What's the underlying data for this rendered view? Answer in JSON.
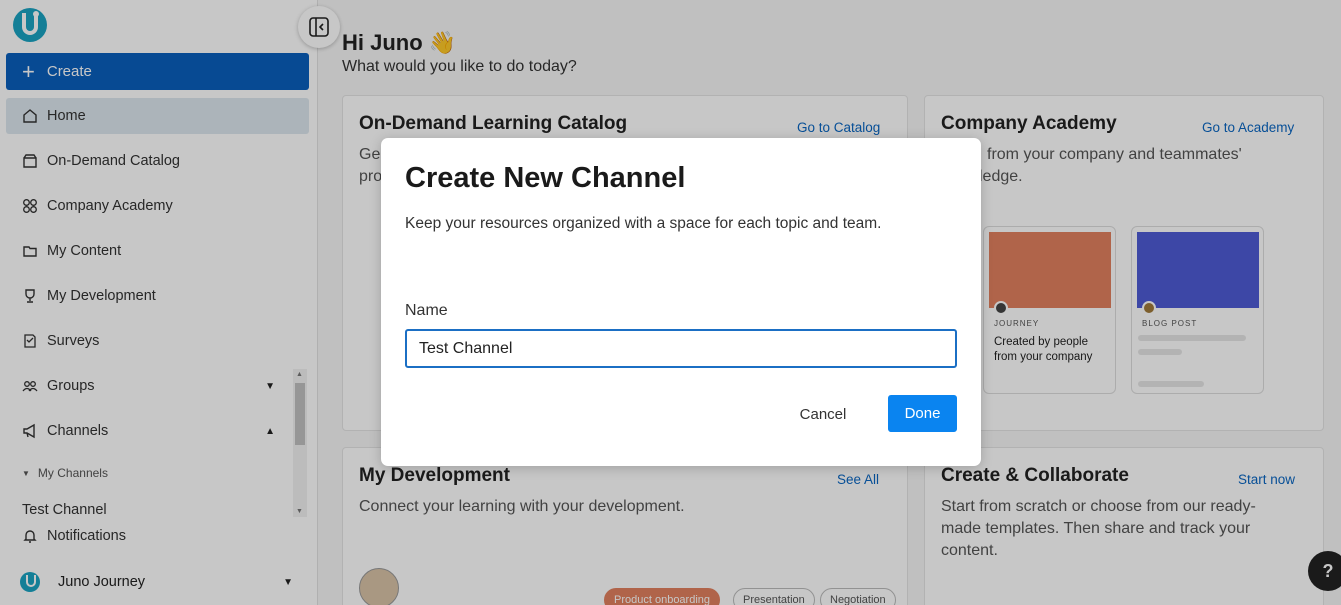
{
  "sidebar": {
    "create_label": "Create",
    "items": [
      {
        "label": "Home",
        "icon": "home-icon"
      },
      {
        "label": "On-Demand Catalog",
        "icon": "store-icon"
      },
      {
        "label": "Company Academy",
        "icon": "grid-icon"
      },
      {
        "label": "My Content",
        "icon": "folder-icon"
      },
      {
        "label": "My Development",
        "icon": "trophy-icon"
      },
      {
        "label": "Surveys",
        "icon": "survey-icon"
      },
      {
        "label": "Groups",
        "icon": "people-icon"
      },
      {
        "label": "Channels",
        "icon": "megaphone-icon"
      }
    ],
    "my_channels_label": "My Channels",
    "channel_item": "Test Channel",
    "notifications_label": "Notifications",
    "user_name": "Juno Journey"
  },
  "greeting": {
    "title": "Hi Juno",
    "emoji": "👋",
    "subtitle": "What would you like to do today?"
  },
  "cards": {
    "catalog": {
      "title": "On-Demand Learning Catalog",
      "link": "Go to Catalog",
      "desc_partial_1": "Ge",
      "desc_partial_2": "pro"
    },
    "academy": {
      "title": "Company Academy",
      "link": "Go to Academy",
      "desc_line_1": "from your company and teammates'",
      "desc_line_2": "ledge.",
      "journey_kind": "JOURNEY",
      "journey_caption": "Created by people from your company",
      "blog_kind": "BLOG POST"
    },
    "development": {
      "title": "My Development",
      "link": "See All",
      "desc": "Connect your learning with your development.",
      "tags": [
        "Product onboarding",
        "Presentation",
        "Negotiation"
      ]
    },
    "create": {
      "title": "Create & Collaborate",
      "link": "Start now",
      "desc": "Start from scratch or choose from our ready-made templates. Then share and track your content."
    }
  },
  "modal": {
    "title": "Create New Channel",
    "description": "Keep your resources organized with a space for each topic and team.",
    "name_label": "Name",
    "name_value": "Test Channel",
    "cancel_label": "Cancel",
    "done_label": "Done"
  },
  "help_label": "?",
  "colors": {
    "primary": "#0a5fbd",
    "done": "#0a84f0",
    "link": "#0a66c2",
    "journey_thumb": "#e2805f",
    "blog_thumb": "#4f5bd5",
    "logo": "#1aa3c2"
  }
}
